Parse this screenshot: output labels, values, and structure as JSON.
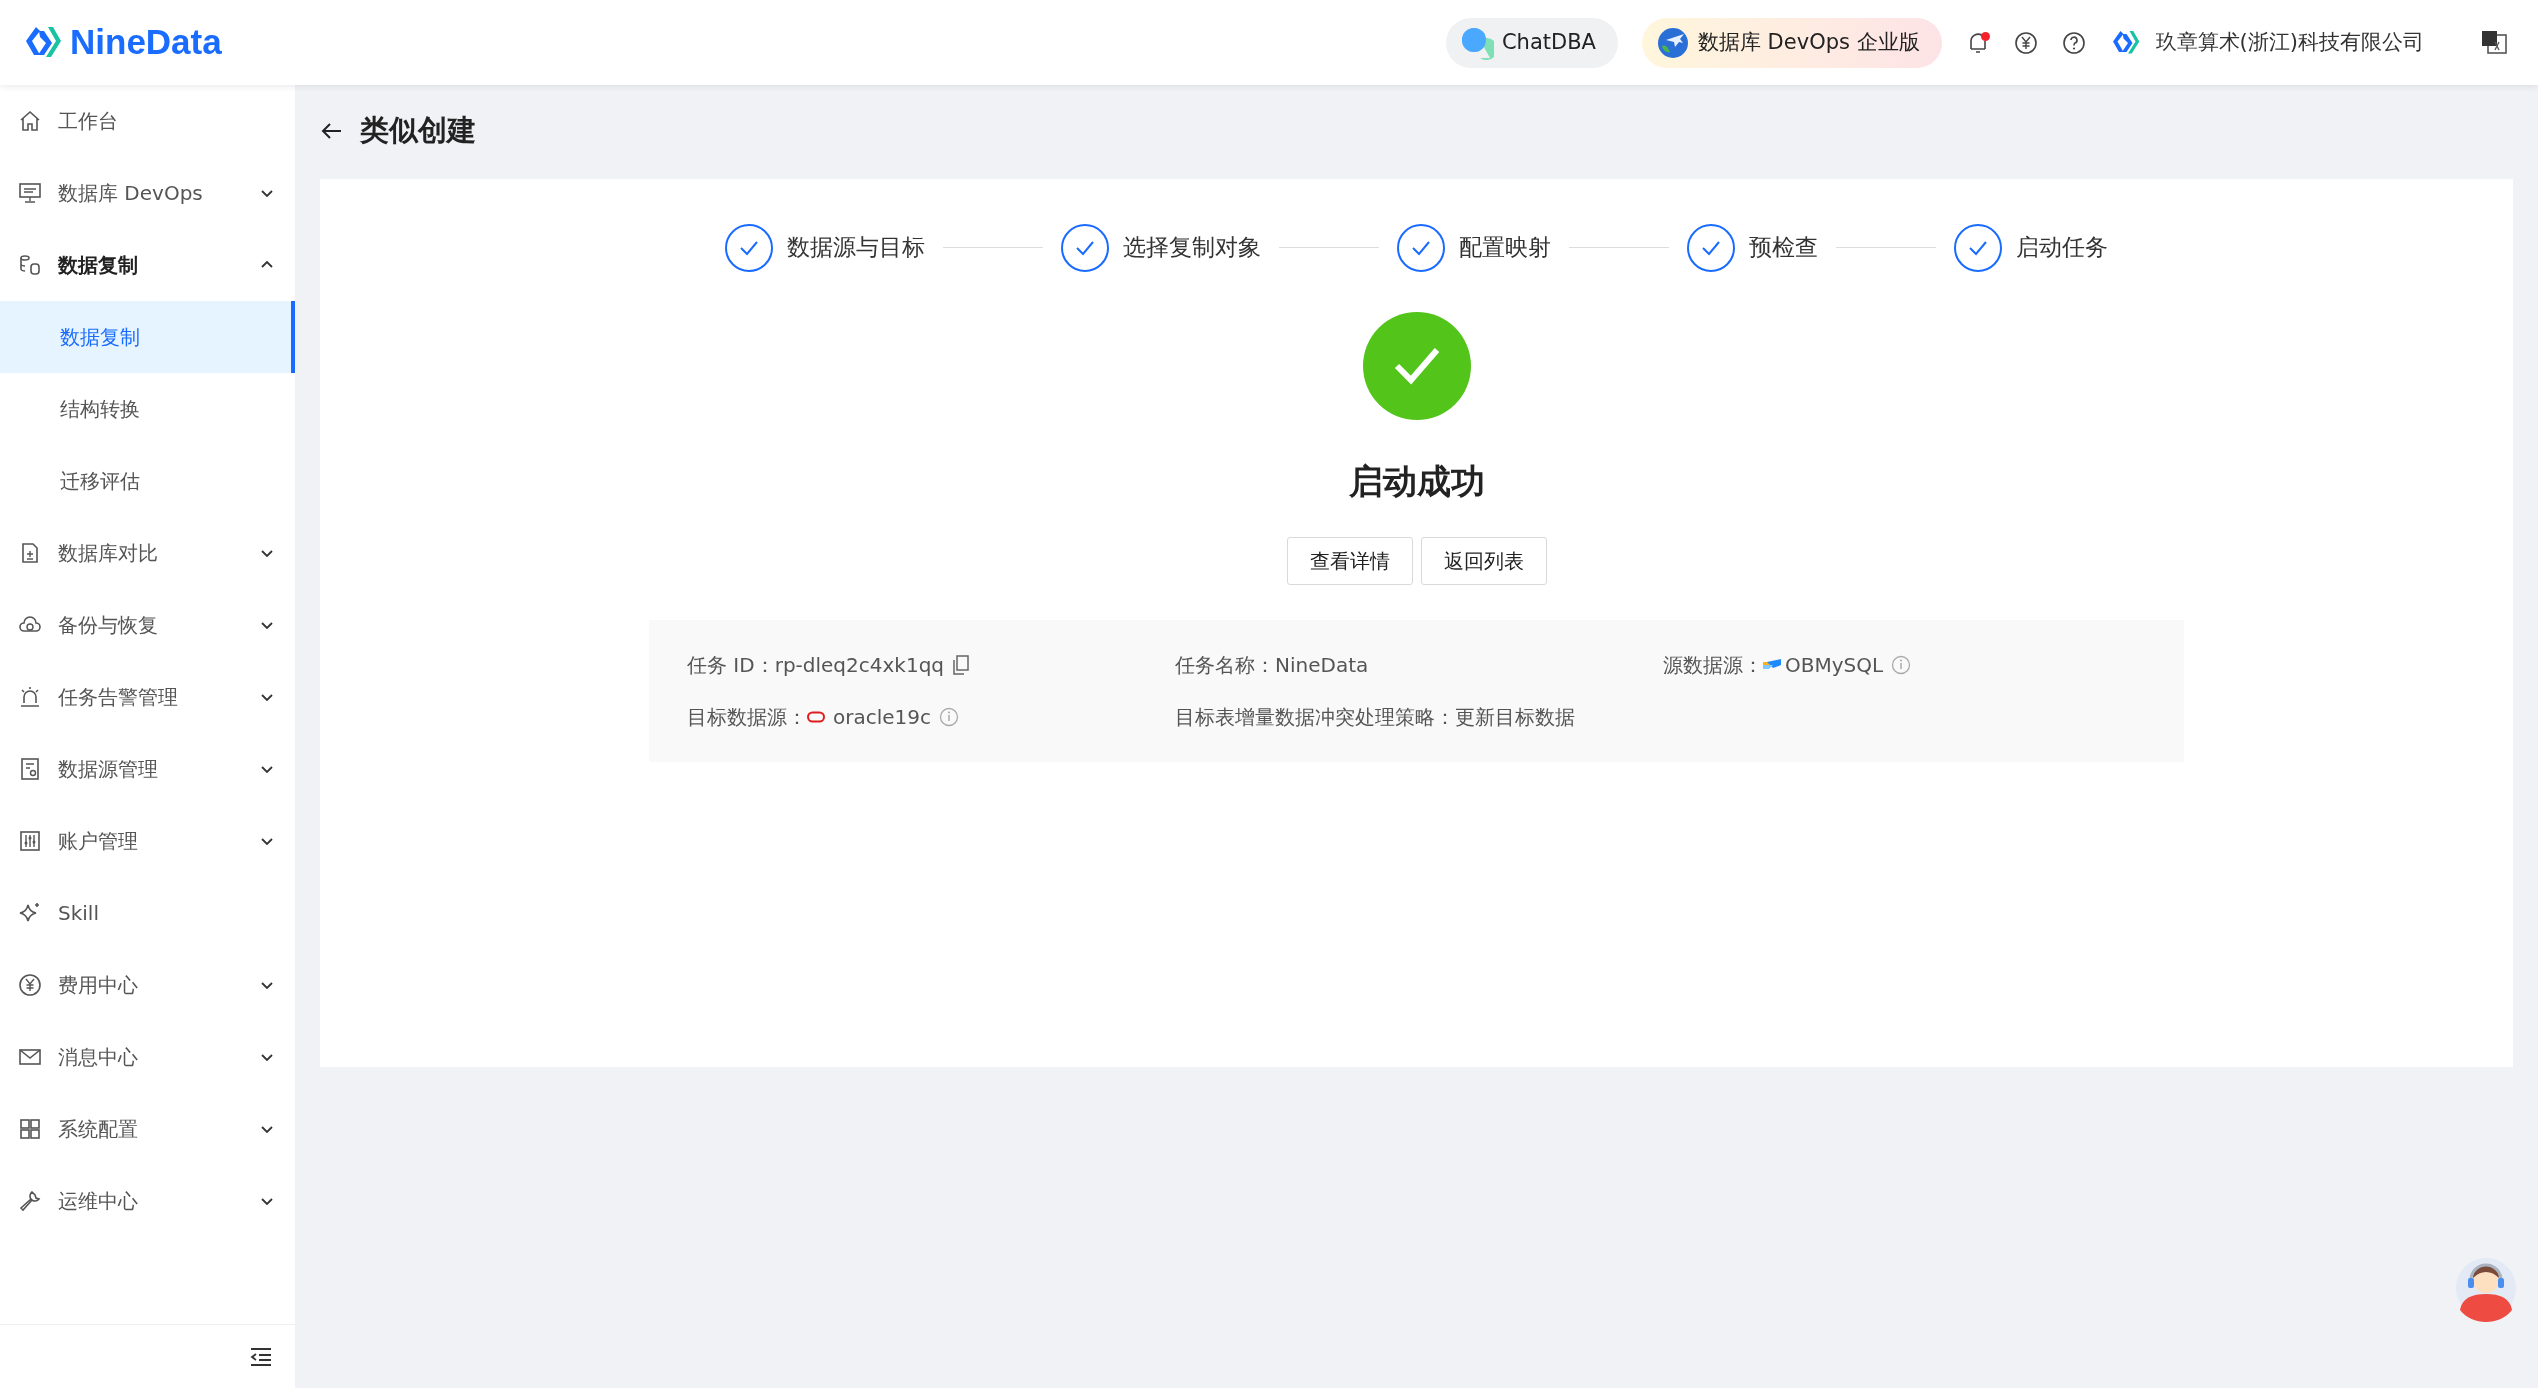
{
  "header": {
    "logo_text": "NineData",
    "chat_button": "ChatDBA",
    "edition": "数据库 DevOps 企业版",
    "notification_unread": true,
    "company": "玖章算术(浙江)科技有限公司"
  },
  "sidebar": {
    "items": [
      {
        "label": "工作台",
        "selected": false
      },
      {
        "label": "数据库 DevOps",
        "selected": false,
        "expanded": false
      },
      {
        "label": "数据复制",
        "selected": false,
        "expanded": true,
        "children": [
          {
            "label": "数据复制",
            "selected": true
          },
          {
            "label": "结构转换",
            "selected": false
          },
          {
            "label": "迁移评估",
            "selected": false
          }
        ]
      },
      {
        "label": "数据库对比",
        "selected": false,
        "expanded": false
      },
      {
        "label": "备份与恢复",
        "selected": false,
        "expanded": false
      },
      {
        "label": "任务告警管理",
        "selected": false,
        "expanded": false
      },
      {
        "label": "数据源管理",
        "selected": false,
        "expanded": false
      },
      {
        "label": "账户管理",
        "selected": false,
        "expanded": false
      },
      {
        "label": "Skill",
        "selected": false
      },
      {
        "label": "费用中心",
        "selected": false,
        "expanded": false
      },
      {
        "label": "消息中心",
        "selected": false,
        "expanded": false
      },
      {
        "label": "系统配置",
        "selected": false,
        "expanded": false
      },
      {
        "label": "运维中心",
        "selected": false,
        "expanded": false
      }
    ]
  },
  "page_title": "类似创建",
  "steps": [
    {
      "label": "数据源与目标",
      "done": true
    },
    {
      "label": "选择复制对象",
      "done": true
    },
    {
      "label": "配置映射",
      "done": true
    },
    {
      "label": "预检查",
      "done": true
    },
    {
      "label": "启动任务",
      "done": true
    }
  ],
  "result": {
    "title": "启动成功",
    "buttons": [
      "查看详情",
      "返回列表"
    ]
  },
  "info": [
    {
      "kind": "id",
      "label": "任务 ID：",
      "value": "rp-dleq2c4xk1qq"
    },
    {
      "kind": "name",
      "label": "任务名称：",
      "value": "NineData"
    },
    {
      "kind": "source",
      "label": "源数据源：",
      "value": "OBMySQL"
    },
    {
      "kind": "target",
      "label": "目标数据源：",
      "value": "oracle19c"
    },
    {
      "kind": "policy",
      "label": "目标表增量数据冲突处理策略：",
      "value": "更新目标数据"
    }
  ]
}
